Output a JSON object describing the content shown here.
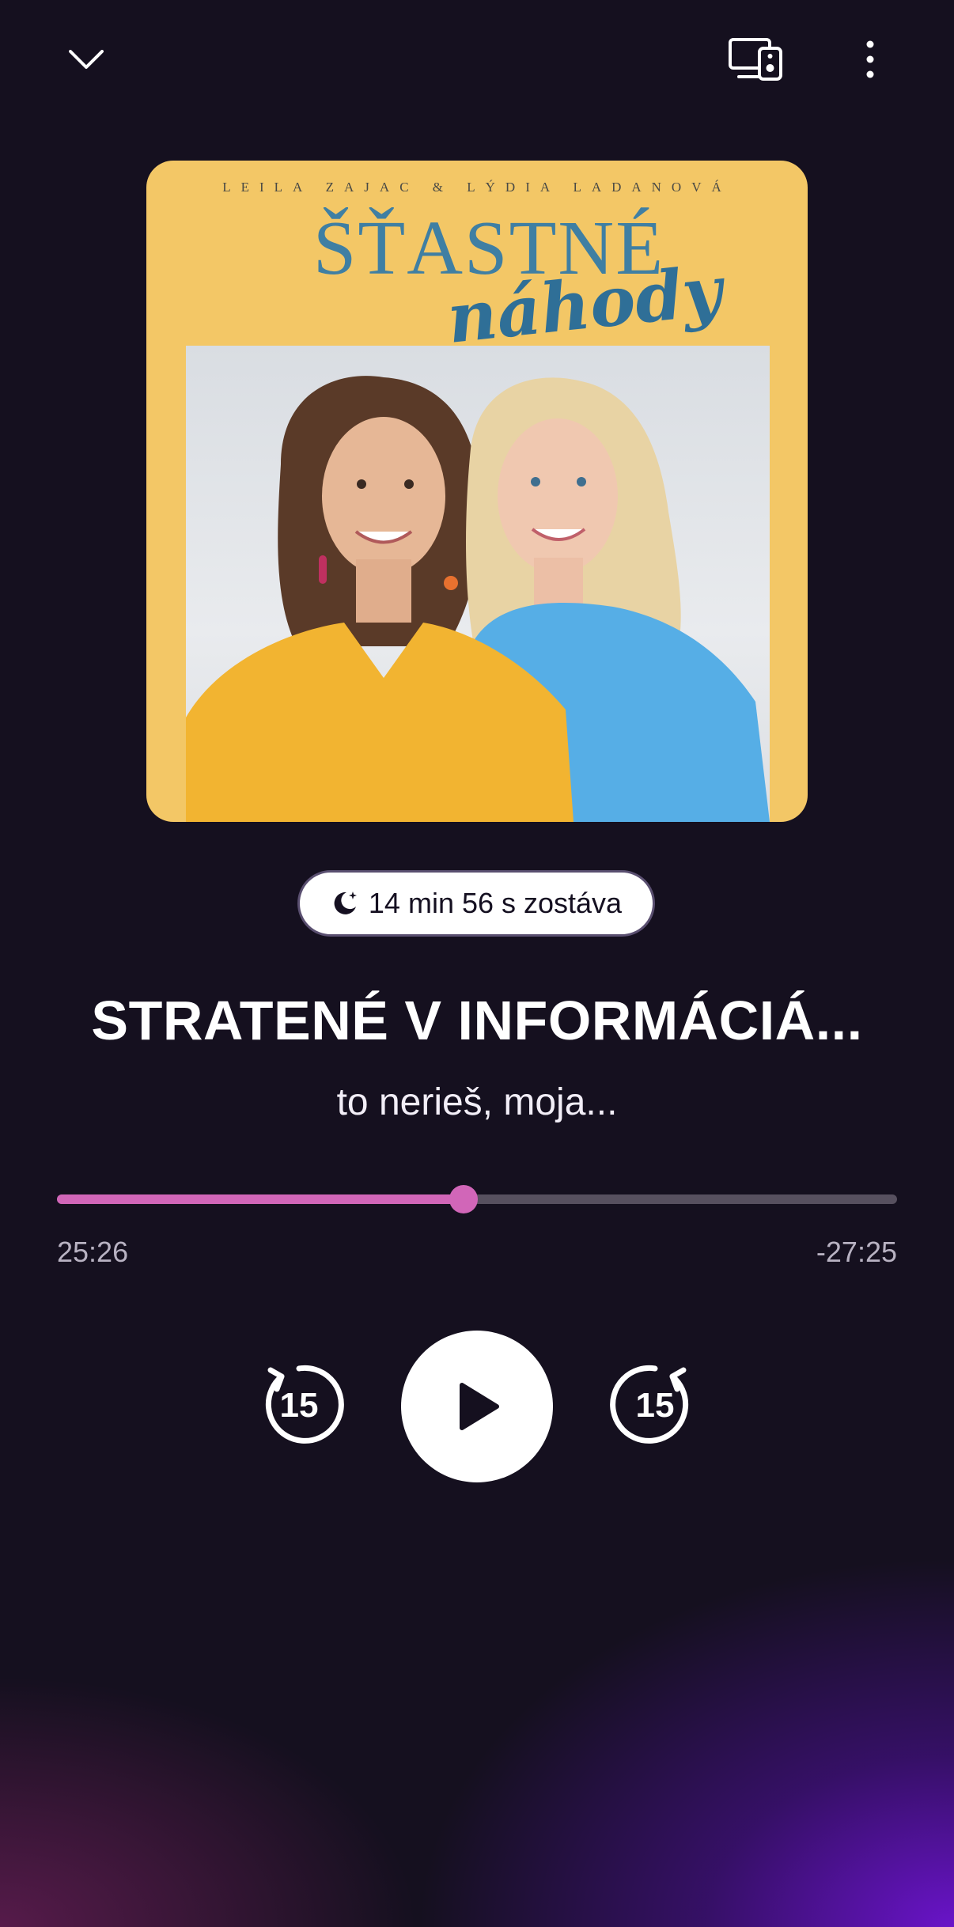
{
  "header": {
    "collapse_icon": "chevron-down-icon",
    "cast_icon": "devices-cast-icon",
    "more_icon": "more-vertical-icon"
  },
  "artwork": {
    "authors": "LEILA ZAJAC & LÝDIA LADANOVÁ",
    "title_line1": "ŠŤASTNÉ",
    "title_line2": "náhody",
    "background_color": "#f3c766",
    "title_color": "#3f7fa3"
  },
  "sleep_timer": {
    "icon": "sleep-moon-icon",
    "label": "14 min 56 s  zostáva"
  },
  "episode": {
    "title": "STRATENÉ V INFORMÁCIÁ...",
    "subtitle": "to nerieš, moja..."
  },
  "progress": {
    "fraction": 0.484,
    "elapsed": "25:26",
    "remaining": "-27:25",
    "fill_color": "#d166b8",
    "track_color": "#57505f"
  },
  "controls": {
    "rewind_seconds": "15",
    "forward_seconds": "15",
    "rewind_icon": "rewind-15-icon",
    "play_icon": "play-icon",
    "forward_icon": "forward-15-icon"
  },
  "theme": {
    "background": "#15101f",
    "accent": "#d166b8",
    "glow": "#6e14d2"
  }
}
